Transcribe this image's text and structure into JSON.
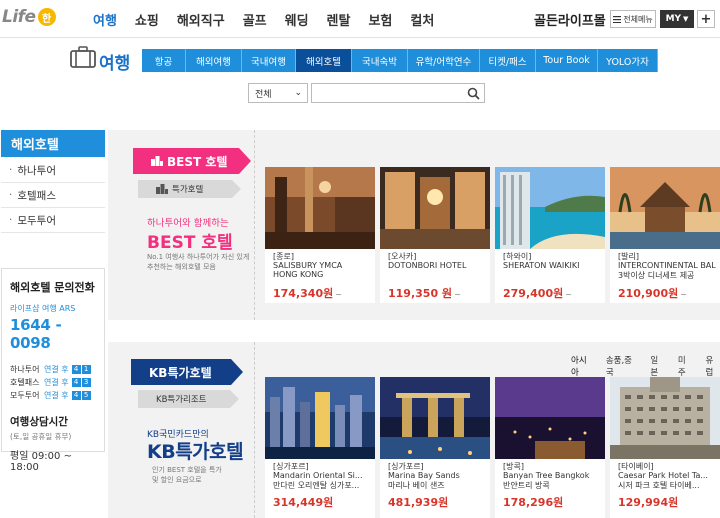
{
  "header": {
    "logo": "Life",
    "logo_badge": "한",
    "nav": [
      {
        "label": "여행",
        "active": true
      },
      {
        "label": "쇼핑",
        "active": false
      },
      {
        "label": "해외직구",
        "active": false
      },
      {
        "label": "골프",
        "active": false
      },
      {
        "label": "웨딩",
        "active": false
      },
      {
        "label": "렌탈",
        "active": false
      },
      {
        "label": "보험",
        "active": false
      },
      {
        "label": "컬처",
        "active": false
      }
    ],
    "golden_life": "골든라이프몰",
    "all_menu": "전체메뉴",
    "my": "MY",
    "plus": "+"
  },
  "subheader": {
    "title": "여행",
    "tabs": [
      {
        "label": "항공",
        "active": false
      },
      {
        "label": "해외여행",
        "active": false
      },
      {
        "label": "국내여행",
        "active": false
      },
      {
        "label": "해외호텔",
        "active": true
      },
      {
        "label": "국내숙박",
        "active": false
      },
      {
        "label": "유학/어학연수",
        "active": false
      },
      {
        "label": "티켓/패스",
        "active": false
      },
      {
        "label": "Tour Book",
        "active": false
      },
      {
        "label": "YOLO가자",
        "active": false
      }
    ]
  },
  "search": {
    "select_value": "전체",
    "placeholder": ""
  },
  "sidebar": {
    "title": "해외호텔",
    "items": [
      "하나투어",
      "호텔패스",
      "모두투어"
    ],
    "contact": {
      "title": "해외호텔 문의전화",
      "sub": "라이프샵 여행 ARS",
      "phone": "1644 - 0098",
      "rows": [
        {
          "label": "하나투어",
          "conn": "연결 후",
          "keys": [
            "4",
            "1"
          ]
        },
        {
          "label": "호텔패스",
          "conn": "연결 후",
          "keys": [
            "4",
            "3"
          ]
        },
        {
          "label": "모두투어",
          "conn": "연결 후",
          "keys": [
            "4",
            "5"
          ]
        }
      ],
      "hours_title": "여행상담시간",
      "hours_sub": "(토,일 공휴일 휴무)",
      "hours": "평일 09:00 ~ 18:00"
    }
  },
  "best_section": {
    "ribbon": "BEST 호텔",
    "sub_ribbon": "특가호텔",
    "promo_small": "하나투어와 함께하는",
    "promo_big": "BEST 호텔",
    "promo_desc": "No.1 여행사 하나투어가 자신 있게 추천하는 해외호텔 모음",
    "cards": [
      {
        "city": "[종로]",
        "name1": "SALISBURY YMCA",
        "name2": "HONG KONG",
        "price": "174,340원",
        "suffix": "~"
      },
      {
        "city": "[오사카]",
        "name1": "DOTONBORI HOTEL",
        "name2": "",
        "price": "119,350 원",
        "suffix": "~"
      },
      {
        "city": "[하와이]",
        "name1": "SHERATON WAIKIKI",
        "name2": "",
        "price": "279,400원",
        "suffix": "~"
      },
      {
        "city": "[발리]",
        "name1": "INTERCONTINENTAL BALI",
        "name2": "3박이상 디너세트 제공",
        "price": "210,900원",
        "suffix": "~"
      }
    ]
  },
  "kb_section": {
    "ribbon": "KB특가호텔",
    "sub_ribbon": "KB특가리조트",
    "promo_small": "KB국민카드만의",
    "promo_big": "KB특가호텔",
    "promo_desc": "인기 BEST 호텔을 특가 및 할인 요금으로",
    "region_tabs": [
      {
        "label": "아시아",
        "active": true
      },
      {
        "label": "송품,중국",
        "active": false
      },
      {
        "label": "일본",
        "active": false
      },
      {
        "label": "미주",
        "active": false
      },
      {
        "label": "유럽",
        "active": false
      }
    ],
    "cards": [
      {
        "city": "[싱가포르]",
        "name1": "Mandarin Oriental Si...",
        "name2": "만다린 오리엔탈 싱가포...",
        "price": "314,449원"
      },
      {
        "city": "[싱가포르]",
        "name1": "Marina Bay Sands",
        "name2": "마리나 베이 샌즈",
        "price": "481,939원"
      },
      {
        "city": "[방콕]",
        "name1": "Banyan Tree Bangkok",
        "name2": "반얀트리 방콕",
        "price": "178,296원"
      },
      {
        "city": "[타이베이]",
        "name1": "Caesar Park Hotel Ta...",
        "name2": "시저 파크 호텔 타이베...",
        "price": "129,994원"
      }
    ]
  },
  "colors": {
    "accent_blue": "#1f8fdb",
    "active_tab": "#0a4f9a",
    "pink": "#f2307f",
    "navy": "#133e88",
    "price_red": "#d8352a"
  }
}
